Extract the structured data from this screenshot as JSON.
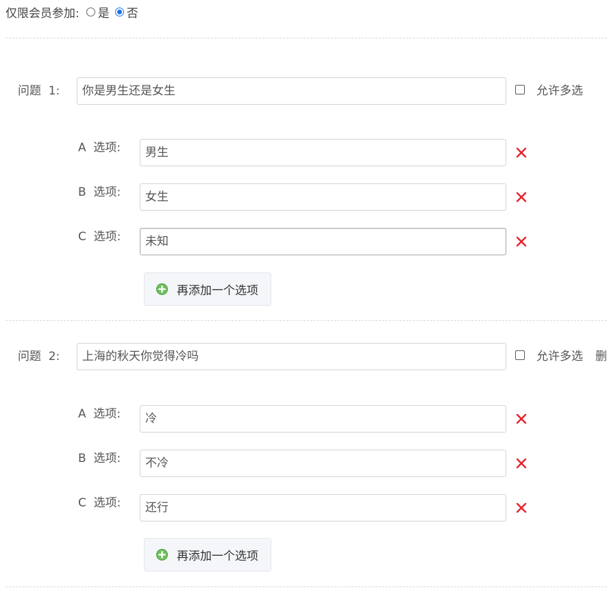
{
  "member_only": {
    "label": "仅限会员参加:",
    "options": [
      {
        "label": "是",
        "selected": false
      },
      {
        "label": "否",
        "selected": true
      }
    ]
  },
  "questions": [
    {
      "label": "问题  1:",
      "text": "你是男生还是女生",
      "allow_multi_label": "允许多选",
      "allow_multi_checked": false,
      "delete_label": "",
      "options": [
        {
          "label": "A  选项:",
          "value": "男生"
        },
        {
          "label": "B  选项:",
          "value": "女生"
        },
        {
          "label": "C  选项:",
          "value": "未知"
        }
      ],
      "add_option_label": "再添加一个选项"
    },
    {
      "label": "问题  2:",
      "text": "上海的秋天你觉得冷吗",
      "allow_multi_label": "允许多选",
      "allow_multi_checked": false,
      "delete_label": "删",
      "options": [
        {
          "label": "A  选项:",
          "value": "冷"
        },
        {
          "label": "B  选项:",
          "value": "不冷"
        },
        {
          "label": "C  选项:",
          "value": "还行"
        }
      ],
      "add_option_label": "再添加一个选项"
    }
  ],
  "colors": {
    "delete_x": "#e8202a",
    "radio_selected": "#1a73e8",
    "add_icon": "#5cb85c",
    "add_btn_bg": "#f4f6f9"
  },
  "icons": {
    "delete": "close-x-icon",
    "add": "plus-circle-icon"
  }
}
